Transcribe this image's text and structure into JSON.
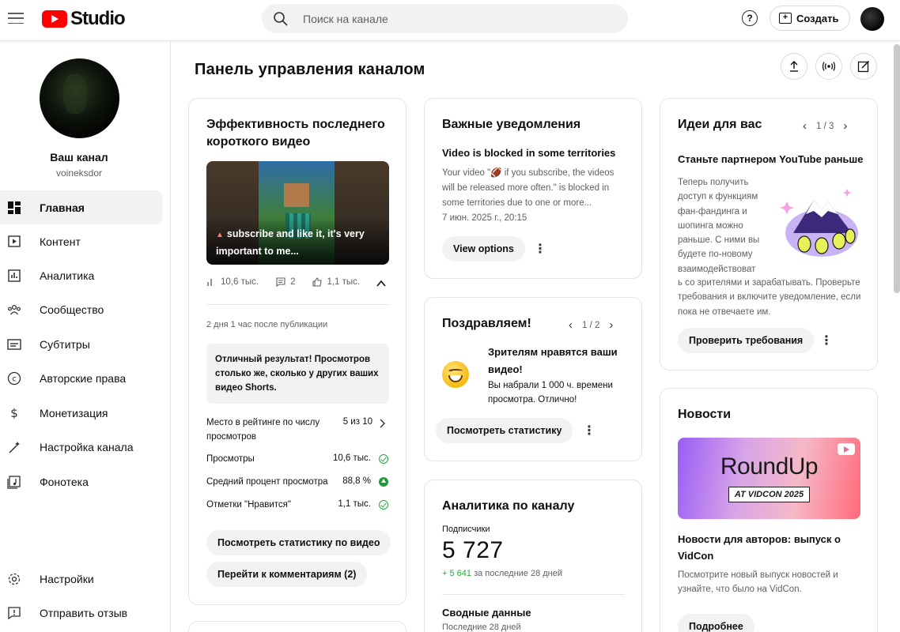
{
  "header": {
    "logo_text": "Studio",
    "search_placeholder": "Поиск на канале",
    "create_label": "Создать",
    "help_glyph": "?"
  },
  "sidebar": {
    "channel_name": "Ваш канал",
    "channel_handle": "voineksdor",
    "items": [
      {
        "label": "Главная",
        "icon": "dashboard-icon",
        "active": true
      },
      {
        "label": "Контент",
        "icon": "content-icon"
      },
      {
        "label": "Аналитика",
        "icon": "analytics-icon"
      },
      {
        "label": "Сообщество",
        "icon": "community-icon"
      },
      {
        "label": "Субтитры",
        "icon": "subtitles-icon"
      },
      {
        "label": "Авторские права",
        "icon": "copyright-icon"
      },
      {
        "label": "Монетизация",
        "icon": "monetization-icon"
      },
      {
        "label": "Настройка канала",
        "icon": "customization-icon"
      },
      {
        "label": "Фонотека",
        "icon": "audio-library-icon"
      }
    ],
    "bottom_items": [
      {
        "label": "Настройки",
        "icon": "settings-icon"
      },
      {
        "label": "Отправить отзыв",
        "icon": "feedback-icon"
      }
    ]
  },
  "main": {
    "page_title": "Панель управления каналом",
    "short_card": {
      "title": "Эффективность последнего короткого видео",
      "thumb_caption": "subscribe and like it, it's very important to me...",
      "views": "10,6 тыс.",
      "comments": "2",
      "likes": "1,1 тыс.",
      "time_since": "2 дня 1 час после публикации",
      "highlight": "Отличный результат! Просмотров столько же, сколько у других ваших видео Shorts.",
      "rank_label": "Место в рейтинге по числу просмотров",
      "rank_value": "5 из 10",
      "views_label": "Просмотры",
      "views_value": "10,6 тыс.",
      "avg_label": "Средний процент просмотра",
      "avg_value": "88,8 %",
      "likes_label": "Отметки \"Нравится\"",
      "likes_value": "1,1 тыс.",
      "btn_stats": "Посмотреть статистику по видео",
      "btn_comments": "Перейти к комментариям (2)"
    },
    "notifications_card": {
      "title": "Важные уведомления",
      "item_title": "Video is blocked in some territories",
      "item_body": "Your video \"🏈 if you subscribe, the videos will be released more often.\" is blocked in some territories due to one or more...",
      "item_date": "7 июн. 2025 г., 20:15",
      "btn_label": "View options"
    },
    "congrats_card": {
      "title": "Поздравляем!",
      "pager": "1 / 2",
      "headline": "Зрителям нравятся ваши видео!",
      "body": "Вы набрали 1 000 ч. времени просмотра. Отлично!",
      "btn_label": "Посмотреть статистику"
    },
    "analytics_card": {
      "title": "Аналитика по каналу",
      "subs_label": "Подписчики",
      "subs_value": "5 727",
      "subs_delta_plus": "+ 5 641",
      "subs_delta_text": " за последние 28 дней",
      "summary_title": "Сводные данные",
      "summary_sub": "Последние 28 дней"
    },
    "ideas_card": {
      "title": "Идеи для вас",
      "pager": "1 / 3",
      "item_title": "Станьте партнером YouTube раньше",
      "body_top": "Теперь получить доступ к функциям фан-фандинга и шопинга можно раньше. С ними вы будете по-новому взаимодействоват",
      "body_bottom": "ь со зрителями и зарабатывать. Проверьте требования и включите уведомление, если пока не отвечаете им.",
      "btn_label": "Проверить требования"
    },
    "news_card": {
      "title": "Новости",
      "banner_title": "RoundUp",
      "banner_tag": "AT VIDCON 2025",
      "item_title": "Новости для авторов: выпуск о VidCon",
      "item_body": "Посмотрите новый выпуск новостей и узнайте, что было на VidCon.",
      "btn_label": "Подробнее"
    }
  }
}
